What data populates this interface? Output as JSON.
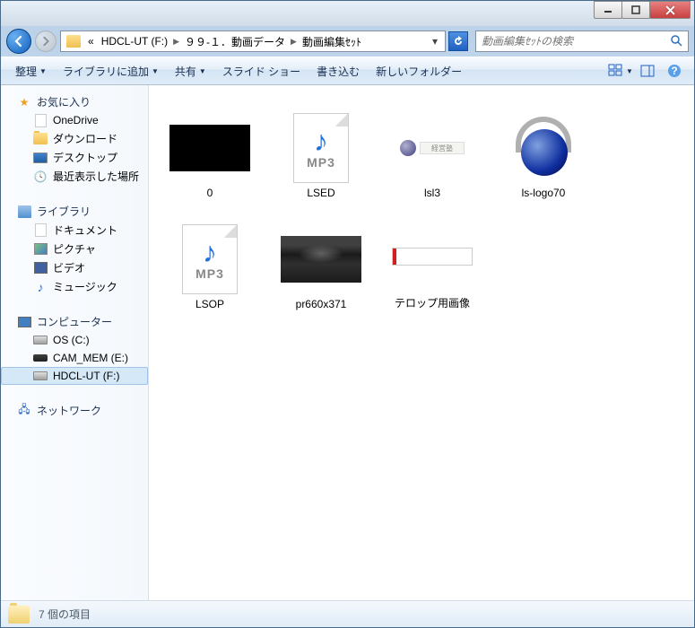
{
  "breadcrumb": {
    "prefix": "«",
    "parts": [
      "HDCL-UT (F:)",
      "９９-１．動画データ",
      "動画編集ｾｯﾄ"
    ]
  },
  "search": {
    "placeholder": "動画編集ｾｯﾄの検索"
  },
  "toolbar": {
    "organize": "整理",
    "library": "ライブラリに追加",
    "share": "共有",
    "slideshow": "スライド ショー",
    "burn": "書き込む",
    "newfolder": "新しいフォルダー"
  },
  "sidebar": {
    "favorites": {
      "label": "お気に入り",
      "items": [
        "OneDrive",
        "ダウンロード",
        "デスクトップ",
        "最近表示した場所"
      ]
    },
    "libraries": {
      "label": "ライブラリ",
      "items": [
        "ドキュメント",
        "ピクチャ",
        "ビデオ",
        "ミュージック"
      ]
    },
    "computer": {
      "label": "コンピューター",
      "items": [
        "OS (C:)",
        "CAM_MEM (E:)",
        "HDCL-UT (F:)"
      ]
    },
    "network": {
      "label": "ネットワーク"
    }
  },
  "files": [
    {
      "name": "0",
      "type": "black"
    },
    {
      "name": "LSED",
      "type": "mp3"
    },
    {
      "name": "lsl3",
      "type": "lsl3"
    },
    {
      "name": "ls-logo70",
      "type": "globe"
    },
    {
      "name": "LSOP",
      "type": "mp3"
    },
    {
      "name": "pr660x371",
      "type": "pr"
    },
    {
      "name": "テロップ用画像",
      "type": "telop"
    }
  ],
  "mp3_label": "MP3",
  "lsl3_text": "経営塾",
  "status": "7 個の項目"
}
